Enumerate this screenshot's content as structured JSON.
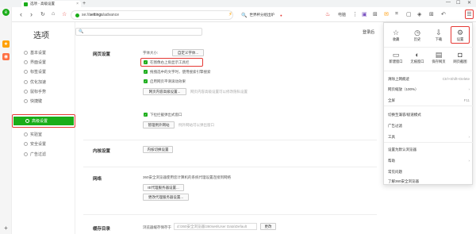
{
  "window": {
    "tab_title": "选项 - 高级设置",
    "new_tab": "+",
    "min": "—",
    "max": "☐",
    "close": "✕"
  },
  "toolbar": {
    "url_prefix": "se://",
    "url_highlight": "settings",
    "url_suffix": "/advance",
    "search_text": "世界杯分组出炉",
    "pc_label": "电脑",
    "accent": "#1aad19"
  },
  "sidebar": {
    "title": "选项",
    "items": [
      {
        "label": "基本设置",
        "icon": "gear-icon"
      },
      {
        "label": "界面设置",
        "icon": "layout-icon"
      },
      {
        "label": "标签设置",
        "icon": "tag-icon"
      },
      {
        "label": "优化加速",
        "icon": "rocket-icon"
      },
      {
        "label": "鼠标手势",
        "icon": "mouse-icon"
      },
      {
        "label": "快捷键",
        "icon": "keyboard-icon"
      },
      {
        "label": "高级设置",
        "icon": "advanced-icon",
        "active": true
      },
      {
        "label": "实验室",
        "icon": "lab-icon"
      },
      {
        "label": "安全设置",
        "icon": "shield-icon"
      },
      {
        "label": "广告过滤",
        "icon": "block-icon"
      }
    ]
  },
  "main": {
    "search_placeholder": "",
    "login_label": "登录后",
    "web_settings": {
      "title": "网页设置",
      "font_size_label": "字体大小:",
      "custom_font_btn": "自定义字体...",
      "options": [
        "在图像右上角显示工具栏",
        "拖拽选中的文字时，使用搜索引擎搜索",
        "启用网页平滑滚动效果"
      ],
      "content_settings_btn": "网页内容高级设置...",
      "content_settings_hint": "网页内容高级设置可以修改隐私设置",
      "popup_option": "下拉拦截弹出式窗口",
      "popup_btn": "管理例外网站",
      "popup_hint": "例外网站可以弹出窗口"
    },
    "builtin": {
      "title": "内核设置",
      "btn": "内核切换设置"
    },
    "network": {
      "title": "网络",
      "desc": "360安全浏览器使用您计算机的系统代理设置连接到网络",
      "proxy_btn": "IE代理服务器设置...",
      "custom_proxy_btn": "更改代理服务器设置..."
    },
    "downloads": {
      "title": "缓存目录",
      "label": "浏览器缓存保存于",
      "path": "d:\\360安全浏览器\\360se6\\User Data\\Default",
      "btn": "更改"
    }
  },
  "menu": {
    "quick": [
      {
        "label": "收藏",
        "icon": "star-icon"
      },
      {
        "label": "历史",
        "icon": "clock-icon"
      },
      {
        "label": "下载",
        "icon": "download-icon"
      },
      {
        "label": "设置",
        "icon": "gear-icon"
      }
    ],
    "quick2": [
      {
        "label": "新建窗口",
        "icon": "window-icon"
      },
      {
        "label": "无痕窗口",
        "icon": "incognito-icon"
      },
      {
        "label": "保存网页",
        "icon": "save-icon"
      },
      {
        "label": "网页截图",
        "icon": "camera-icon"
      }
    ],
    "items": [
      {
        "label": "清除上网痕迹",
        "shortcut": "Ctrl+Shift+Delete"
      },
      {
        "label": "网页缩放（100%）",
        "shortcut": "›"
      },
      {
        "label": "全屏",
        "shortcut": "F11"
      },
      {
        "label": "切换至兼容/极速模式",
        "shortcut": ""
      },
      {
        "label": "广告过滤",
        "shortcut": ""
      },
      {
        "label": "工具",
        "shortcut": "›"
      },
      {
        "label": "设置为默认浏览器",
        "shortcut": ""
      },
      {
        "label": "帮助",
        "shortcut": "›"
      },
      {
        "label": "常见问题",
        "shortcut": ""
      },
      {
        "label": "了解360安全浏览器",
        "shortcut": ""
      }
    ]
  }
}
